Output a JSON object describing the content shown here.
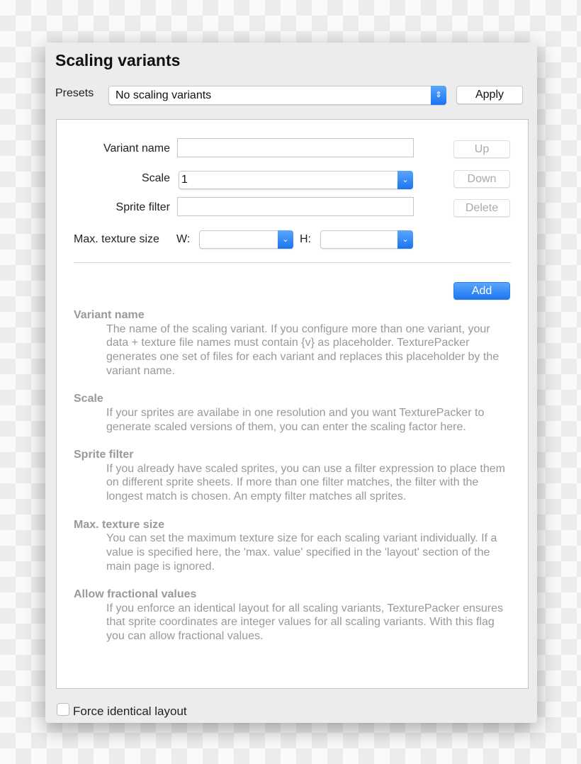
{
  "dialog": {
    "title": "Scaling variants"
  },
  "presets": {
    "label": "Presets",
    "value": "No scaling variants",
    "apply_label": "Apply"
  },
  "form": {
    "variant_name_label": "Variant name",
    "variant_name_value": "",
    "scale_label": "Scale",
    "scale_value": "1",
    "sprite_filter_label": "Sprite filter",
    "sprite_filter_value": "",
    "max_texture_label": "Max. texture size",
    "w_label": "W:",
    "w_value": "",
    "h_label": "H:",
    "h_value": ""
  },
  "buttons": {
    "up": "Up",
    "down": "Down",
    "delete": "Delete",
    "add": "Add"
  },
  "help": [
    {
      "title": "Variant name",
      "text": "The name of the scaling variant. If you configure more than one variant, your data + texture file names must contain {v} as placeholder. TexturePacker generates one set of files for each variant and replaces this placeholder by the variant name."
    },
    {
      "title": "Scale",
      "text": "If your sprites are availabe in one resolution and you want TexturePacker to generate scaled versions of them, you can enter the scaling factor here."
    },
    {
      "title": "Sprite filter",
      "text": "If you already have scaled sprites, you can use a filter expression to place them on different sprite sheets. If more than one filter matches, the filter with the longest match is chosen. An empty filter matches all sprites."
    },
    {
      "title": "Max. texture size",
      "text": "You can set the maximum texture size for each scaling variant individually. If a value is specified here, the 'max. value' specified in the 'layout' section of the main page is ignored."
    },
    {
      "title": "Allow fractional values",
      "text": "If you enforce an identical layout for all scaling variants, TexturePacker ensures that sprite coordinates are integer values for all scaling variants. With this flag you can allow fractional values."
    }
  ],
  "footer": {
    "force_identical_label": "Force identical layout",
    "force_identical_checked": false
  },
  "colors": {
    "accent": "#1d76f1"
  }
}
